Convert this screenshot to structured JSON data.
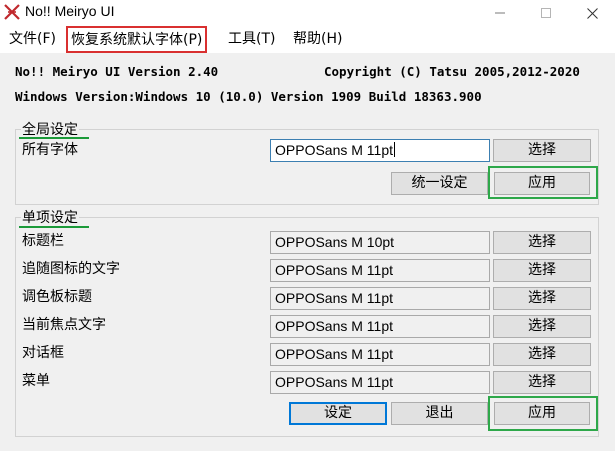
{
  "window": {
    "title": "No!! Meiryo UI",
    "controls": {
      "minimize_icon": "minimize-icon",
      "maximize_icon": "maximize-icon",
      "close_icon": "close-icon"
    }
  },
  "menu": {
    "file": "文件(F)",
    "restore_default_font": "恢复系统默认字体(P)",
    "tools": "工具(T)",
    "help": "帮助(H)"
  },
  "info": {
    "version": "No!! Meiryo UI Version 2.40",
    "copyright": "Copyright (C) Tatsu 2005,2012-2020",
    "windows_version": "Windows Version:Windows 10 (10.0) Version 1909 Build 18363.900"
  },
  "global_settings": {
    "group_title": "全局设定",
    "all_fonts_label": "所有字体",
    "all_fonts_value": "OPPOSans M  11pt",
    "select_label": "选择",
    "unify_label": "统一设定",
    "apply_label": "应用"
  },
  "individual_settings": {
    "group_title": "单项设定",
    "rows": [
      {
        "label": "标题栏",
        "value": "OPPOSans M  10pt",
        "select_label": "选择"
      },
      {
        "label": "追随图标的文字",
        "value": "OPPOSans M  11pt",
        "select_label": "选择"
      },
      {
        "label": "调色板标题",
        "value": "OPPOSans M  11pt",
        "select_label": "选择"
      },
      {
        "label": "当前焦点文字",
        "value": "OPPOSans M  11pt",
        "select_label": "选择"
      },
      {
        "label": "对话框",
        "value": "OPPOSans M  11pt",
        "select_label": "选择"
      },
      {
        "label": "菜单",
        "value": "OPPOSans M  11pt",
        "select_label": "选择"
      }
    ],
    "set_label": "设定",
    "exit_label": "退出",
    "apply_label": "应用"
  },
  "colors": {
    "menu_highlight_border": "#d93030",
    "annotation_green": "#2ea84a",
    "default_button_border": "#0078d7"
  }
}
